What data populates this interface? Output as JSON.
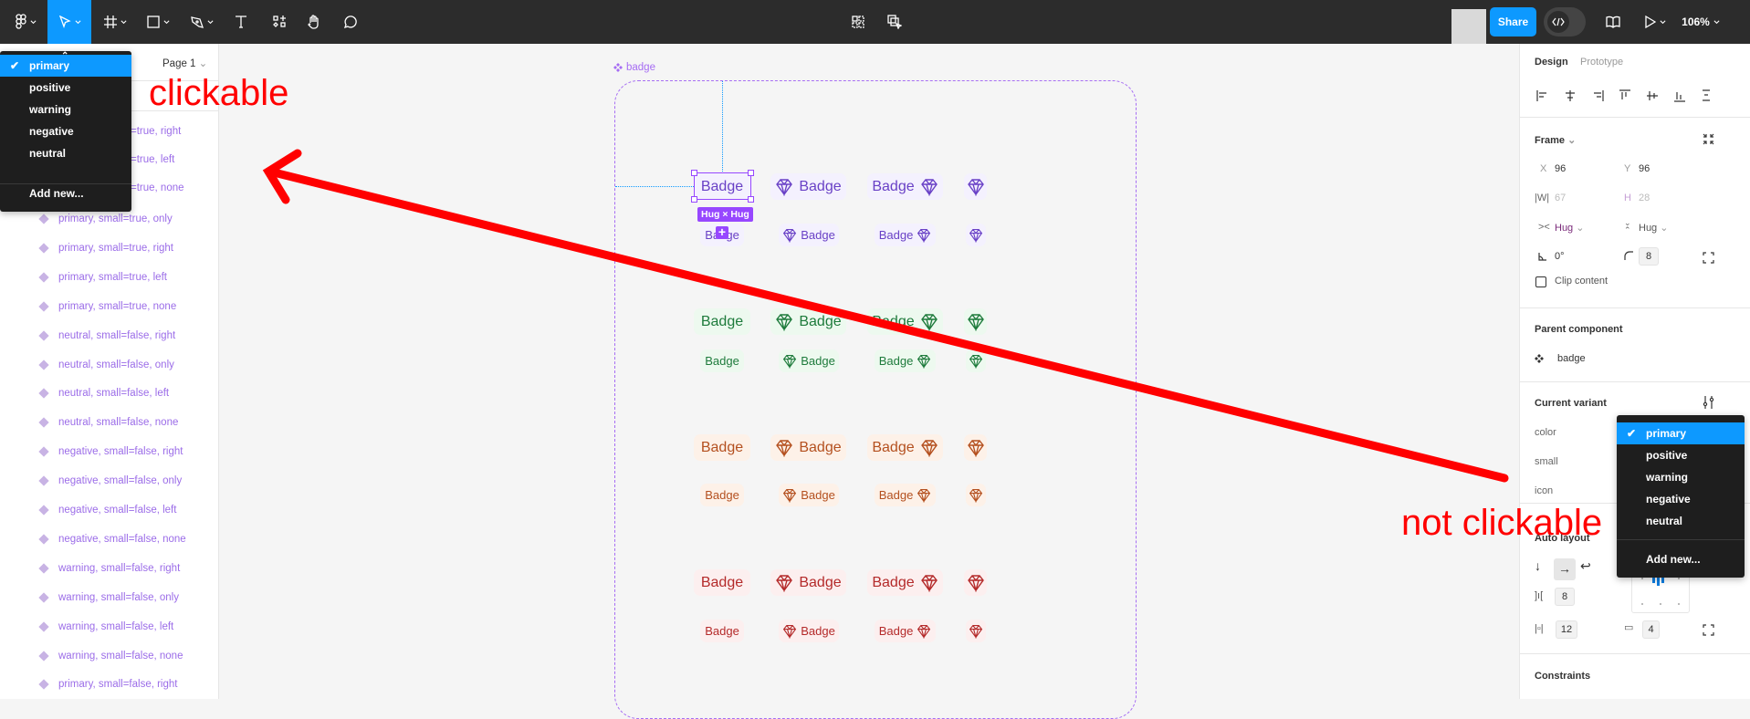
{
  "toolbar": {
    "tools": [
      "figma-menu",
      "move",
      "frame",
      "rectangle",
      "pen",
      "text",
      "resources",
      "hand",
      "comment"
    ],
    "active_tool": "move",
    "share_label": "Share",
    "zoom_label": "106%",
    "accent": "#0d99ff"
  },
  "left_panel": {
    "page_label": "Page 1",
    "dropdown": {
      "items": [
        "primary",
        "positive",
        "warning",
        "negative",
        "neutral"
      ],
      "selected": "primary",
      "add_new": "Add new..."
    },
    "partial_layers": [
      "=true, right",
      "=true, left",
      "=true, none"
    ],
    "layers": [
      "primary, small=true, only",
      "primary, small=true, right",
      "primary, small=true, left",
      "primary, small=true, none",
      "neutral, small=false, right",
      "neutral, small=false, only",
      "neutral, small=false, left",
      "neutral, small=false, none",
      "negative, small=false, right",
      "negative, small=false, only",
      "negative, small=false, left",
      "negative, small=false, none",
      "warning, small=false, right",
      "warning, small=false, only",
      "warning, small=false, left",
      "warning, small=false, none",
      "primary, small=false, right"
    ]
  },
  "annotations": {
    "clickable": "clickable",
    "not_clickable": "not clickable",
    "color": "#ff0000"
  },
  "canvas": {
    "frame_label": "badge",
    "selection_label": "Hug × Hug",
    "badge_text": "Badge",
    "groups": [
      {
        "name": "primary",
        "bg": "#f4f1fe",
        "fg": "#6941c6"
      },
      {
        "name": "positive",
        "bg": "#edf9ef",
        "fg": "#1e7b3c"
      },
      {
        "name": "warning",
        "bg": "#fdf1e8",
        "fg": "#b4501f"
      },
      {
        "name": "negative",
        "bg": "#fcefef",
        "fg": "#b42a2a"
      }
    ]
  },
  "right_panel": {
    "tabs": [
      "Design",
      "Prototype"
    ],
    "active_tab": "Design",
    "frame": {
      "title": "Frame",
      "x_label": "X",
      "x": "96",
      "y_label": "Y",
      "y": "96",
      "w_label": "W",
      "w": "67",
      "h_label": "H",
      "h": "28",
      "width_mode": "Hug",
      "height_mode": "Hug",
      "rotation": "0°",
      "radius": "8",
      "clip_label": "Clip content",
      "clip": false
    },
    "parent": {
      "title": "Parent component",
      "name": "badge"
    },
    "variant": {
      "title": "Current variant",
      "props": [
        "color",
        "small",
        "icon"
      ]
    },
    "variant_dropdown": {
      "items": [
        "primary",
        "positive",
        "warning",
        "negative",
        "neutral"
      ],
      "selected": "primary",
      "add_new": "Add new..."
    },
    "auto_layout": {
      "title": "Auto layout",
      "direction": "horizontal",
      "gap": "8",
      "padding_h": "12",
      "padding_v": "4"
    },
    "constraints": {
      "title": "Constraints"
    }
  }
}
